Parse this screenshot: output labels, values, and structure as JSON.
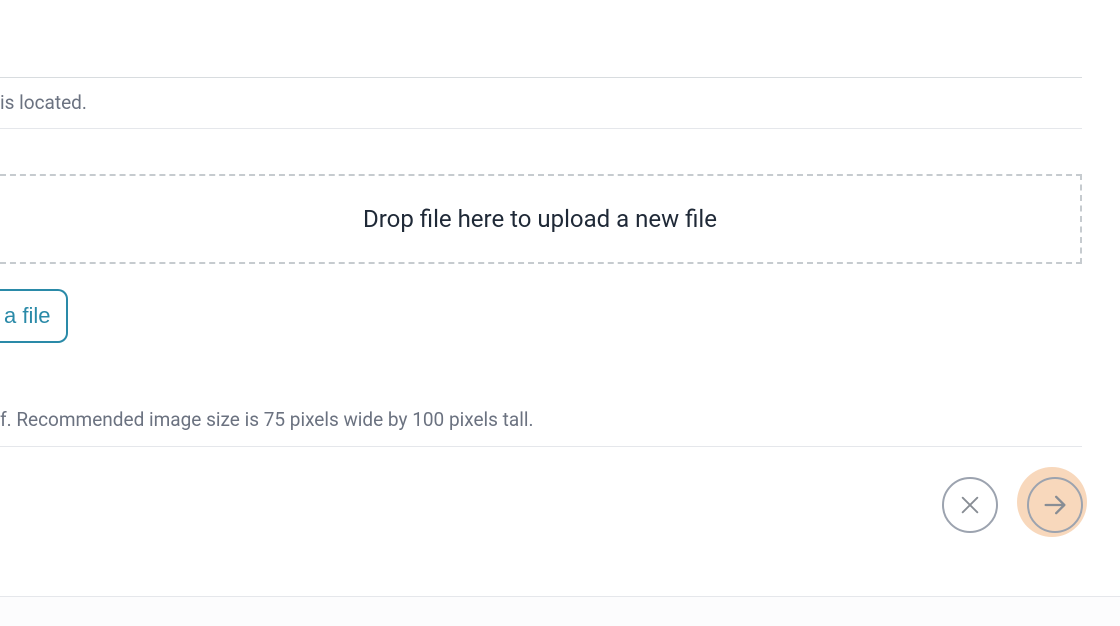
{
  "text": {
    "located_fragment": "is located.",
    "dropzone_label": "Drop file here to upload a new file",
    "select_file_fragment": " a file",
    "recommended_fragment": "f. Recommended image size is 75 pixels wide by 100 pixels tall."
  },
  "buttons": {
    "cancel_icon": "close-icon",
    "next_icon": "arrow-right-icon"
  }
}
